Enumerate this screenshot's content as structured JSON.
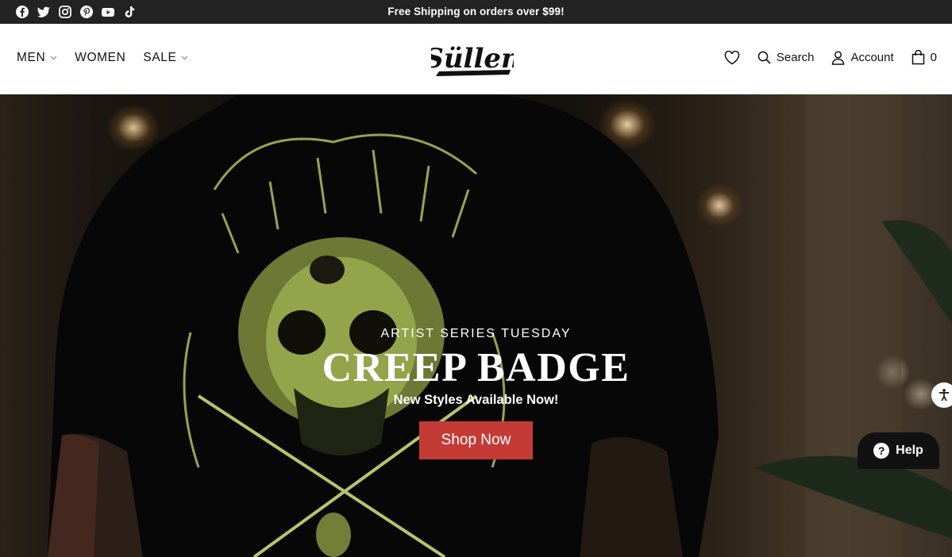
{
  "topbar": {
    "social_icons": [
      "facebook-icon",
      "twitter-icon",
      "instagram-icon",
      "pinterest-icon",
      "youtube-icon",
      "tiktok-icon"
    ],
    "announcement": "Free Shipping on orders over $99!"
  },
  "header": {
    "nav_left": [
      {
        "label": "MEN",
        "has_dropdown": true
      },
      {
        "label": "WOMEN",
        "has_dropdown": false
      },
      {
        "label": "SALE",
        "has_dropdown": true
      }
    ],
    "logo_text": "Süllen",
    "search_label": "Search",
    "account_label": "Account",
    "cart_count": "0"
  },
  "hero": {
    "eyebrow": "ARTIST SERIES TUESDAY",
    "headline": "CREEP BADGE",
    "subtitle": "New Styles Available Now!",
    "cta_label": "Shop Now"
  },
  "widgets": {
    "help_label": "Help"
  },
  "colors": {
    "topbar_bg": "#232323",
    "cta_bg": "#c43b35",
    "print_green": "#a7b45a"
  }
}
